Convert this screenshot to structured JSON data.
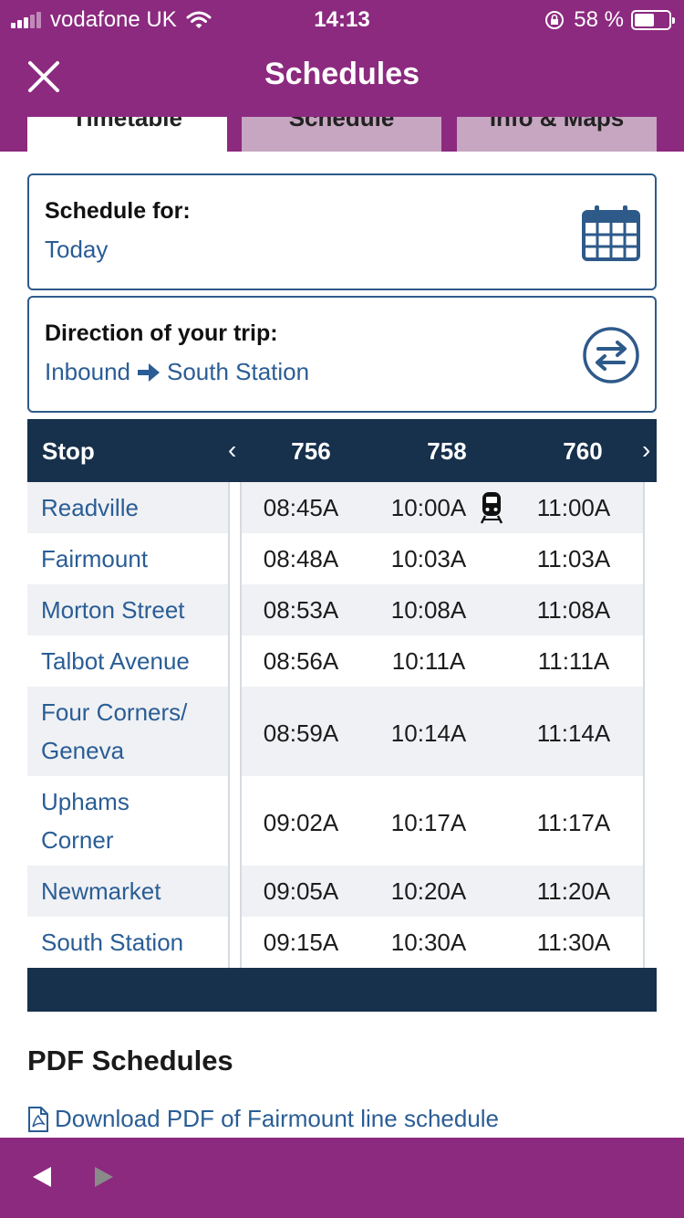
{
  "status_bar": {
    "carrier": "vodafone UK",
    "time": "14:13",
    "battery_text": "58 %",
    "battery_level": 0.58
  },
  "header": {
    "title": "Schedules"
  },
  "tabs": [
    {
      "label": "Timetable",
      "active": true
    },
    {
      "label": "Schedule",
      "active": false
    },
    {
      "label": "Info & Maps",
      "active": false
    }
  ],
  "schedule_for": {
    "label": "Schedule for:",
    "value": "Today"
  },
  "direction": {
    "label": "Direction of your trip:",
    "from": "Inbound",
    "to": "South Station"
  },
  "table": {
    "stop_header": "Stop",
    "prev_arrow": "‹",
    "next_arrow": "›",
    "trains": [
      "756",
      "758",
      "760"
    ],
    "rows": [
      {
        "stop": "Readville",
        "times": [
          "08:45A",
          "10:00A",
          "11:00A"
        ]
      },
      {
        "stop": "Fairmount",
        "times": [
          "08:48A",
          "10:03A",
          "11:03A"
        ]
      },
      {
        "stop": "Morton Street",
        "times": [
          "08:53A",
          "10:08A",
          "11:08A"
        ]
      },
      {
        "stop": "Talbot Avenue",
        "times": [
          "08:56A",
          "10:11A",
          "11:11A"
        ]
      },
      {
        "stop": "Four Corners/ Geneva",
        "times": [
          "08:59A",
          "10:14A",
          "11:14A"
        ]
      },
      {
        "stop": "Uphams Corner",
        "times": [
          "09:02A",
          "10:17A",
          "11:17A"
        ]
      },
      {
        "stop": "Newmarket",
        "times": [
          "09:05A",
          "10:20A",
          "11:20A"
        ]
      },
      {
        "stop": "South Station",
        "times": [
          "09:15A",
          "10:30A",
          "11:30A"
        ]
      }
    ]
  },
  "pdf": {
    "title": "PDF Schedules",
    "link_text": "Download PDF of Fairmount line schedule"
  },
  "colors": {
    "brand_purple": "#8c2a7f",
    "navy": "#17304c",
    "link_blue": "#2a5d95"
  }
}
